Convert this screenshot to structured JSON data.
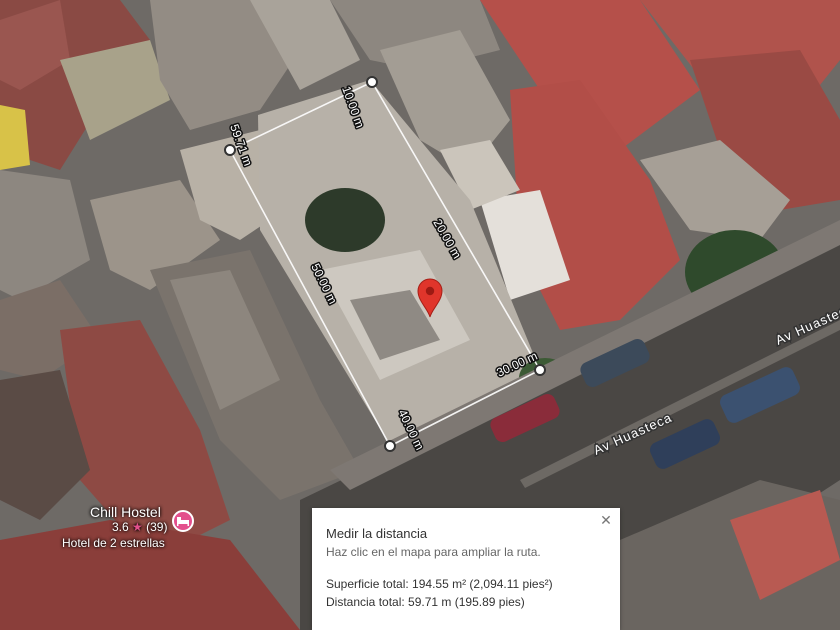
{
  "map": {
    "measure_labels": [
      "10.00 m",
      "59.71 m",
      "20.00 m",
      "50.00 m",
      "30.00 m",
      "40.00 m"
    ],
    "road_labels": [
      "Av Huasteca",
      "Av Huasteca"
    ]
  },
  "poi": {
    "name": "Chill Hostel",
    "rating": "3.6",
    "star": "★",
    "reviews": "(39)",
    "subtitle": "Hotel de 2 estrellas",
    "icon": "hotel-bed-icon"
  },
  "panel": {
    "title": "Medir la distancia",
    "hint": "Haz clic en el mapa para ampliar la ruta.",
    "area": "Superficie total: 194.55 m² (2,094.11 pies²)",
    "distance": "Distancia total: 59.71 m (195.89 pies)",
    "close_icon": "close-icon"
  },
  "colors": {
    "marker": "#e0352b",
    "poi": "#e3508c"
  }
}
